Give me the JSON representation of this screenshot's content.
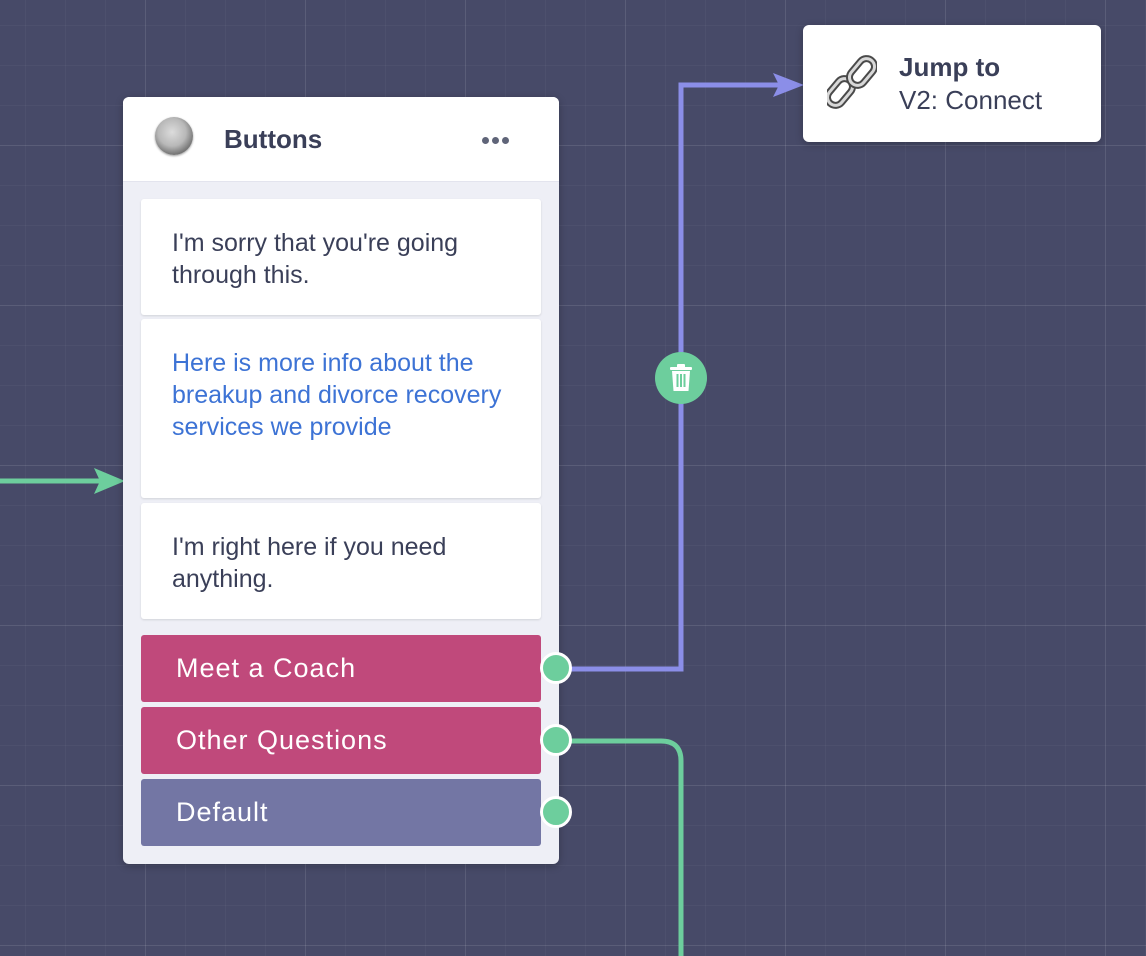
{
  "canvas": {
    "background_color": "#474a68",
    "grid_color": "#5a5d7a"
  },
  "block": {
    "title": "Buttons",
    "icon": "gray-orb-icon",
    "menu_icon": "more-dots-icon",
    "messages": [
      {
        "text": "I'm sorry that you're going through this.",
        "style": "text"
      },
      {
        "text": "Here is more info about the breakup and divorce recovery services we provide",
        "style": "link"
      },
      {
        "text": "I'm right here if you need anything.",
        "style": "text"
      }
    ],
    "buttons": [
      {
        "label": "Meet a Coach",
        "color": "#c0497b"
      },
      {
        "label": "Other Questions",
        "color": "#c0497b"
      },
      {
        "label": "Default",
        "color": "#7376a4"
      }
    ]
  },
  "jump_node": {
    "title": "Jump to",
    "target": "V2: Connect",
    "icon": "link-chain-icon"
  },
  "connections": {
    "delete_icon": "trash-icon",
    "purple_color": "#8b8ee8",
    "green_color": "#6dce9d"
  }
}
